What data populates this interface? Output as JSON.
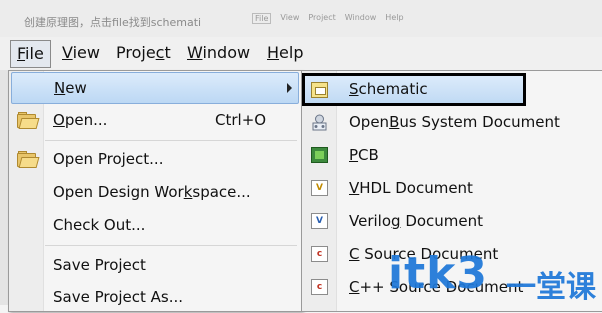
{
  "caption": "创建原理图，点击file找到schemati",
  "mini_menu": [
    "File",
    "View",
    "Project",
    "Window",
    "Help"
  ],
  "menubar": {
    "file": {
      "pre": "",
      "u": "F",
      "post": "ile"
    },
    "view": {
      "pre": "",
      "u": "V",
      "post": "iew"
    },
    "project": {
      "pre": "Proje",
      "u": "c",
      "post": "t"
    },
    "window": {
      "pre": "",
      "u": "W",
      "post": "indow"
    },
    "help": {
      "pre": "",
      "u": "H",
      "post": "elp"
    }
  },
  "file_menu": {
    "new": {
      "pre": "",
      "u": "N",
      "post": "ew"
    },
    "open": {
      "pre": "",
      "u": "O",
      "post": "pen...",
      "shortcut": "Ctrl+O"
    },
    "open_project": "Open Project...",
    "open_workspace": {
      "pre": "Open Design Wor",
      "u": "k",
      "post": "space..."
    },
    "check_out": "Check Out...",
    "save_project": "Save Project",
    "save_project_as": "Save Project As..."
  },
  "new_submenu": {
    "schematic": {
      "pre": "",
      "u": "S",
      "post": "chematic"
    },
    "openbus": {
      "pre": "Open",
      "u": "B",
      "post": "us System Document"
    },
    "pcb": {
      "pre": "",
      "u": "P",
      "post": "CB"
    },
    "vhdl": {
      "pre": "",
      "u": "V",
      "post": "HDL Document"
    },
    "verilog": {
      "pre": "Verilo",
      "u": "g",
      "post": " Document"
    },
    "c_source": {
      "pre": "",
      "u": "C",
      "post": " Source Document"
    },
    "cpp_source": {
      "pre": "",
      "u": "C",
      "post": "++ Source Document"
    }
  },
  "watermark": {
    "text": "itk3",
    "cn": "一堂课"
  },
  "colors": {
    "highlight": "#bcd8f4",
    "watermark": "#1e78d8"
  }
}
